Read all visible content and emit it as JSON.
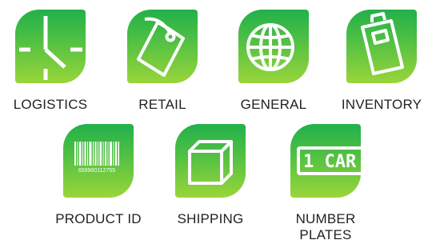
{
  "colors": {
    "tile_top": "#22b04b",
    "tile_mid": "#54c143",
    "tile_bottom": "#9ad53a",
    "icon": "#ffffff",
    "label_text": "#222222"
  },
  "categories": [
    {
      "id": "logistics",
      "label": "LOGISTICS",
      "icon": "clock-icon"
    },
    {
      "id": "retail",
      "label": "RETAIL",
      "icon": "price-tag-icon"
    },
    {
      "id": "general",
      "label": "GENERAL",
      "icon": "globe-icon"
    },
    {
      "id": "inventory",
      "label": "INVENTORY",
      "icon": "clipboard-icon"
    },
    {
      "id": "product-id",
      "label": "PRODUCT ID",
      "icon": "barcode-icon",
      "barcode_number": "659900112755"
    },
    {
      "id": "shipping",
      "label": "SHIPPING",
      "icon": "box-icon"
    },
    {
      "id": "number-plates",
      "label": "NUMBER PLATES",
      "icon": "license-plate-icon",
      "plate_text": "1 CAR"
    }
  ]
}
